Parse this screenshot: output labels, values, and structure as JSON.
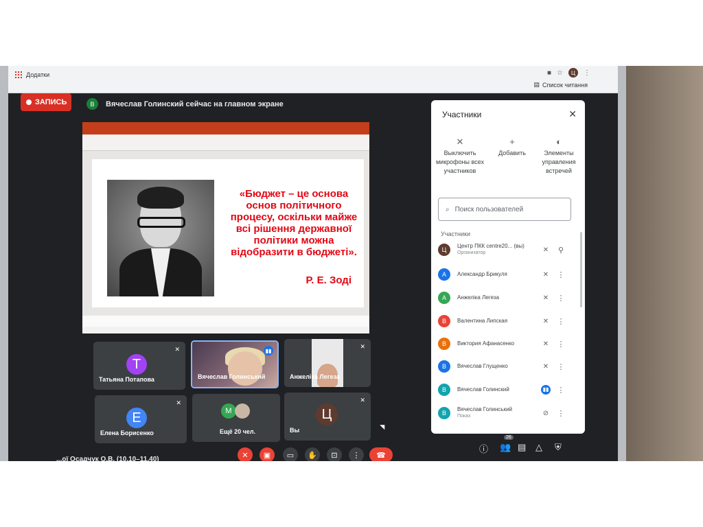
{
  "browser": {
    "bookmark_label": "Додатки",
    "reading_list": "Список читання",
    "profile_initial": "Ц"
  },
  "header": {
    "record_label": "ЗАПИСЬ",
    "presenter_initial": "В",
    "presenter_text": "Вячеслав Голинский сейчас на главном экране"
  },
  "slide": {
    "quote": "«Бюджет – це основа основ політичного процесу, оскільки майже всі рішення державної політики можна відобразити в бюджеті».",
    "author": "Р. Е. Зоді"
  },
  "tiles": [
    {
      "name": "Татьяна Потапова",
      "initial": "Т",
      "color": "#a142f4"
    },
    {
      "name": "Вячеслав Голинський"
    },
    {
      "name": "Анжеліка Легеза"
    },
    {
      "name": "Елена Борисенко",
      "initial": "Е",
      "color": "#4285f4"
    },
    {
      "name": "Ещё 20 чел.",
      "initial": "М",
      "color": "#34a853"
    },
    {
      "name": "Вы",
      "initial": "Ц",
      "color": "#5f3a2e"
    }
  ],
  "bottom": {
    "meeting_text": "...ої Осадчук О.В. (10.10–11.40)",
    "participants_count": "26"
  },
  "panel": {
    "title": "Участники",
    "actions": [
      {
        "label": "Выключить микрофоны всех участников"
      },
      {
        "label": "Добавить"
      },
      {
        "label": "Элементы управления встречей"
      }
    ],
    "search_placeholder": "Поиск пользователей",
    "section_label": "Участники",
    "participants": [
      {
        "initial": "Ц",
        "name": "Центр ПКК centre20... (вы)",
        "sub": "Организатор",
        "color": "#5f3a2e"
      },
      {
        "initial": "А",
        "name": "Александр Брикуля",
        "sub": "",
        "color": "#1a73e8"
      },
      {
        "initial": "А",
        "name": "Анжеліка Легеза",
        "sub": "",
        "color": "#34a853"
      },
      {
        "initial": "В",
        "name": "Валентина Липская",
        "sub": "",
        "color": "#ea4335"
      },
      {
        "initial": "В",
        "name": "Виктория Афанасенко",
        "sub": "",
        "color": "#e8710a"
      },
      {
        "initial": "В",
        "name": "Вячеслав Глущенко",
        "sub": "",
        "color": "#1a73e8"
      },
      {
        "initial": "В",
        "name": "Вячеслав Голинский",
        "sub": "",
        "color": "#12a4af"
      },
      {
        "initial": "В",
        "name": "Вячеслав Голинський",
        "sub": "Показ",
        "color": "#12a4af"
      }
    ]
  }
}
